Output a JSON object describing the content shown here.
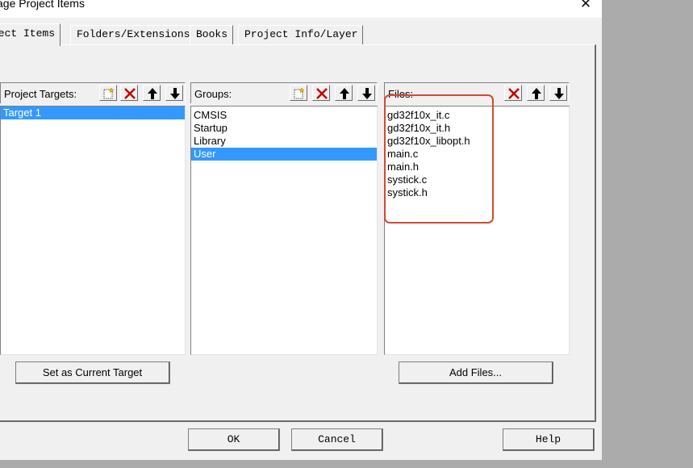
{
  "window": {
    "title": "age Project Items",
    "close_icon": "close-icon"
  },
  "tabs": [
    {
      "label": "ject Items",
      "active": true
    },
    {
      "label": "Folders/Extensions",
      "active": false
    },
    {
      "label": "Books",
      "active": false
    },
    {
      "label": "Project Info/Layer",
      "active": false
    }
  ],
  "targets": {
    "label": "Project Targets:",
    "items": [
      "Target 1"
    ],
    "selected_index": 0,
    "set_current_label": "Set as Current Target"
  },
  "groups": {
    "label": "Groups:",
    "items": [
      "CMSIS",
      "Startup",
      "Library",
      "User"
    ],
    "selected_index": 3
  },
  "files": {
    "label": "Files:",
    "items": [
      "gd32f10x_it.c",
      "gd32f10x_it.h",
      "gd32f10x_libopt.h",
      "main.c",
      "main.h",
      "systick.c",
      "systick.h"
    ],
    "add_files_label": "Add Files..."
  },
  "buttons": {
    "ok": "OK",
    "cancel": "Cancel",
    "help": "Help"
  },
  "colors": {
    "selection": "#3399ff",
    "annotation": "#d14a32"
  }
}
